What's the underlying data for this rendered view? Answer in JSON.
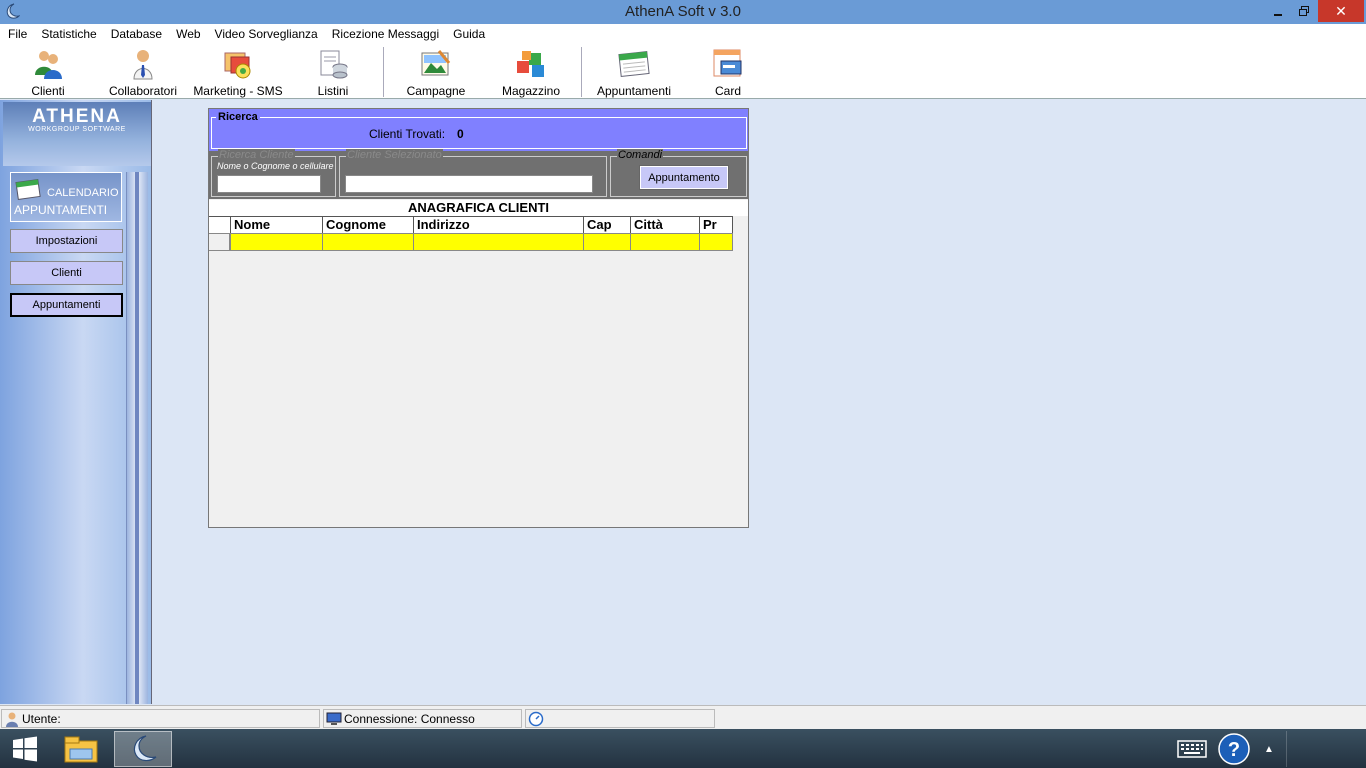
{
  "window": {
    "title": "AthenA Soft v 3.0"
  },
  "menu": [
    "File",
    "Statistiche",
    "Database",
    "Web",
    "Video Sorveglianza",
    "Ricezione Messaggi",
    "Guida"
  ],
  "toolbar": {
    "clienti": "Clienti",
    "collaboratori": "Collaboratori",
    "marketing": "Marketing - SMS",
    "listini": "Listini",
    "campagne": "Campagne",
    "magazzino": "Magazzino",
    "appuntamenti": "Appuntamenti",
    "card": "Card"
  },
  "sidebar": {
    "logo": "ATHENA",
    "logo_sub": "WORKGROUP SOFTWARE",
    "section_title_1": "CALENDARIO",
    "section_title_2": "APPUNTAMENTI",
    "buttons": [
      "Impostazioni",
      "Clienti",
      "Appuntamenti"
    ],
    "active": "Appuntamenti"
  },
  "search": {
    "group_label": "Ricerca",
    "found_label": "Clienti Trovati:",
    "found_count": "0",
    "cliente_legend": "Ricerca Cliente",
    "cliente_hint": "Nome o Cognome o cellulare",
    "cliente_value": "",
    "selezionato_legend": "Cliente Selezionato",
    "selezionato_value": "",
    "comandi_legend": "Comandi",
    "appuntamento_button": "Appuntamento"
  },
  "grid": {
    "title": "ANAGRAFICA CLIENTI",
    "columns": [
      "Nome",
      "Cognome",
      "Indirizzo",
      "Cap",
      "Città",
      "Pr"
    ],
    "rows": [
      [
        "",
        "",
        "",
        "",
        "",
        ""
      ]
    ]
  },
  "status": {
    "utente": "Utente:",
    "connessione": "Connessione: Connesso",
    "clock": ""
  },
  "colors": {
    "titlebar": "#6a9bd6",
    "ricerca_panel": "#8080ff",
    "button": "#c7c8f7",
    "row_highlight": "#ffff00",
    "close_button": "#c7372a"
  }
}
